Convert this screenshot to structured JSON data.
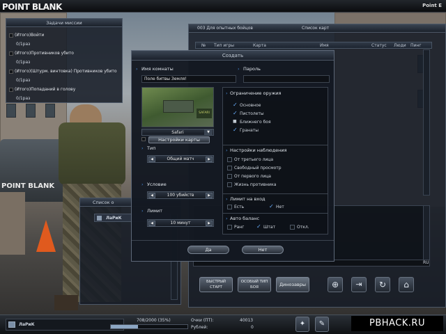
{
  "app": {
    "logo": "POINT BLANK",
    "top_right": "Point E"
  },
  "mission": {
    "title": "Задачи миссии",
    "items": [
      {
        "label": "(Итого)Войти",
        "progress": "0/1раз"
      },
      {
        "label": "(Итого)Противников убито",
        "progress": "0/1раз"
      },
      {
        "label": "(Итого)(Штурм. винтовка) Противников убито",
        "progress": "0/1раз"
      },
      {
        "label": "(Итого)Попаданий в голову",
        "progress": "0/1раз"
      }
    ]
  },
  "room_list": {
    "title": "003 Для опытных бойцов",
    "subtitle": "Список карт",
    "columns": [
      "№",
      "Тип игры",
      "Карта",
      "Имя",
      "Статус",
      "Люди",
      "Пинг"
    ]
  },
  "create_dialog": {
    "title": "Создать",
    "room_name_label": "Имя комнаты",
    "room_name_value": "Поле битвы Земля!",
    "password_label": "Пароль",
    "password_value": "",
    "map_name": "Safari",
    "map_settings_button": "Настройки карты",
    "type_label": "Тип",
    "type_value": "Общий матч",
    "condition_label": "Условие",
    "condition_value": "100 убийств",
    "limit_label": "Лимит",
    "limit_value": "10 минут",
    "weapon_restriction": {
      "title": "Ограничение оружия",
      "options": [
        {
          "label": "Основное",
          "state": "checked"
        },
        {
          "label": "Пистолеты",
          "state": "checked"
        },
        {
          "label": "Ближнего боя",
          "state": "locked"
        },
        {
          "label": "Гранаты",
          "state": "checked"
        }
      ]
    },
    "observer_settings": {
      "title": "Настройки наблюдения",
      "options": [
        {
          "label": "От третьего лица",
          "state": "unchecked"
        },
        {
          "label": "Свободный просмотр",
          "state": "unchecked"
        },
        {
          "label": "От первого лица",
          "state": "unchecked"
        },
        {
          "label": "Жизнь противника",
          "state": "unchecked"
        }
      ]
    },
    "entry_limit": {
      "title": "Лимит на вход",
      "options": [
        {
          "label": "Есть",
          "state": "unchecked"
        },
        {
          "label": "Нет",
          "state": "checked"
        }
      ]
    },
    "auto_balance": {
      "title": "Авто баланс",
      "options": [
        {
          "label": "Ранг",
          "state": "unchecked"
        },
        {
          "label": "Штат",
          "state": "checked"
        },
        {
          "label": "Откл.",
          "state": "unchecked"
        }
      ]
    },
    "ok_button": "Да",
    "cancel_button": "Нет"
  },
  "players_panel": {
    "title": "Список о",
    "player_name": "ЛаРиК"
  },
  "lobby_buttons": {
    "quick_start": "БЫСТРЫЙ СТАРТ",
    "special_mode": "ОСОБЫЙ ТИП БОЯ",
    "dinosaurs": "Динозавры"
  },
  "chat": {
    "lang": "RU"
  },
  "status_bar": {
    "player_name": "ЛаРиК",
    "exp_text": "708/2000 (35%)",
    "exp_fraction": 0.35,
    "points_label": "Очки (ПТ):",
    "points_value": "40013",
    "rubles_label": "Рублей:",
    "rubles_value": "0"
  },
  "watermark": "PBHACK.RU",
  "colors": {
    "accent": "#4a8fe0",
    "panel_bg": "#161c26",
    "border": "#4d5867"
  }
}
